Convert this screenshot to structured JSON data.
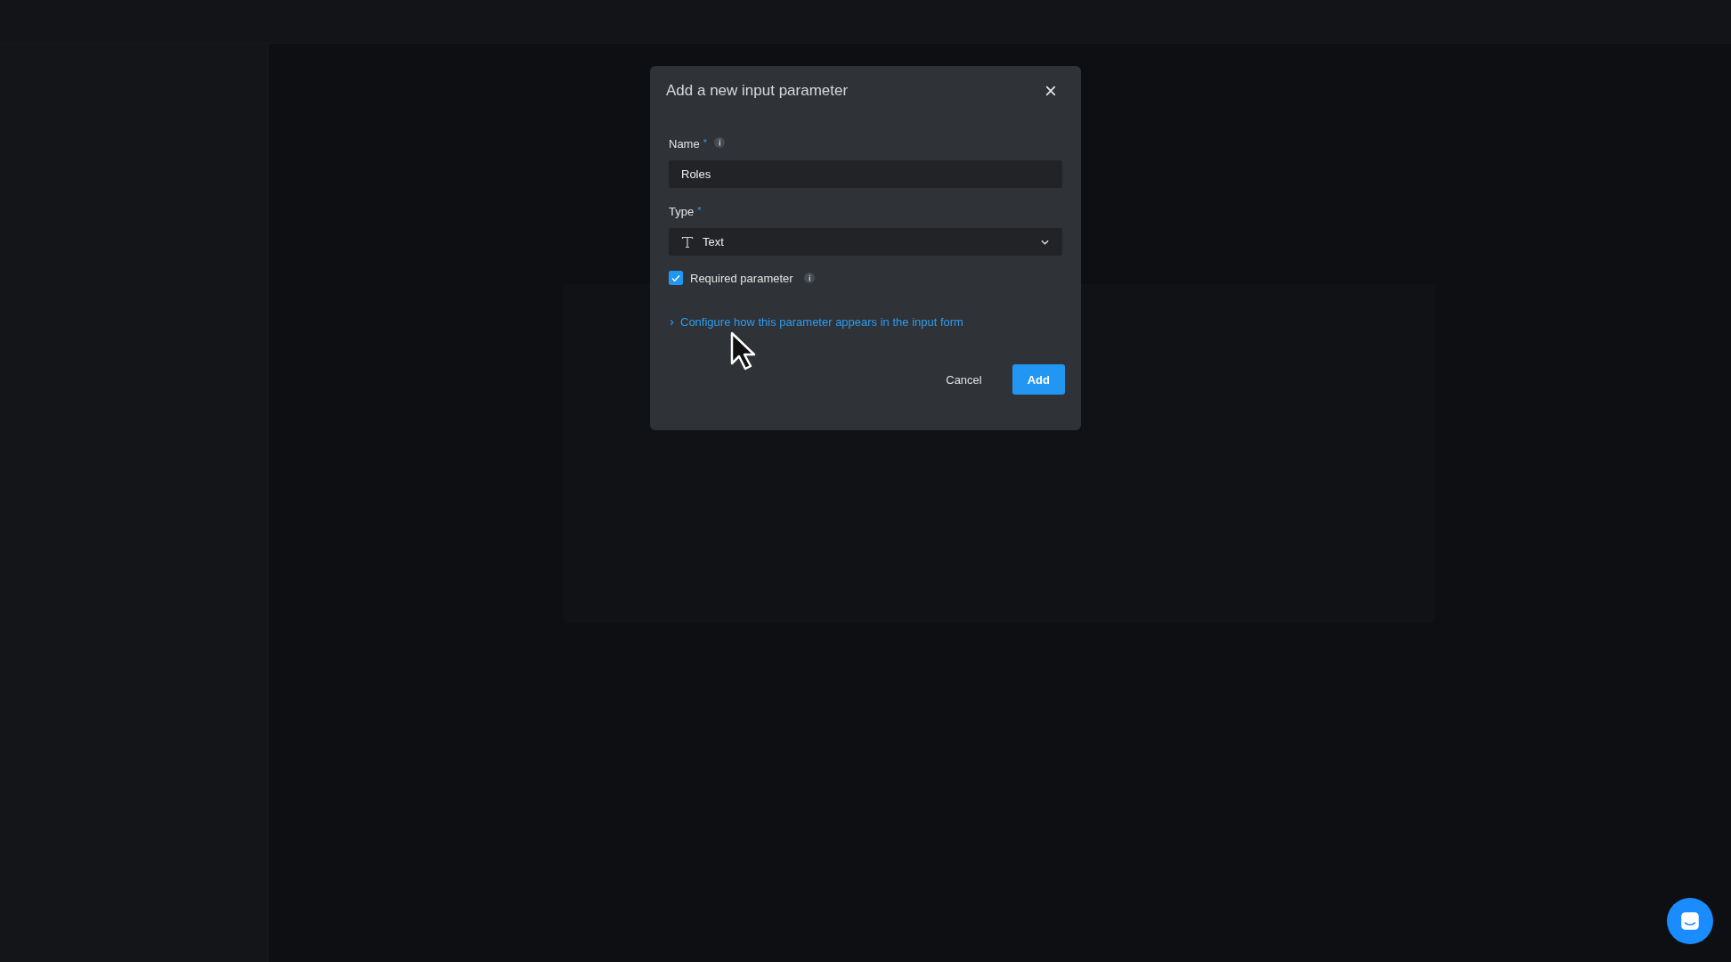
{
  "dialog": {
    "title": "Add a new input parameter",
    "fields": [
      {
        "kind": "text",
        "label": "Name",
        "required_mark": "*",
        "info": true,
        "value": "Roles"
      },
      {
        "kind": "select",
        "label": "Type",
        "required_mark": "*",
        "info": false,
        "value": "Text"
      }
    ],
    "checkbox": {
      "label": "Required parameter",
      "checked": true,
      "info": true
    },
    "disclosure": {
      "label": "Configure how this parameter appears in the input form",
      "expanded": false
    },
    "buttons": [
      {
        "label": "Cancel",
        "kind": "secondary"
      },
      {
        "label": "Add",
        "kind": "primary"
      }
    ]
  }
}
